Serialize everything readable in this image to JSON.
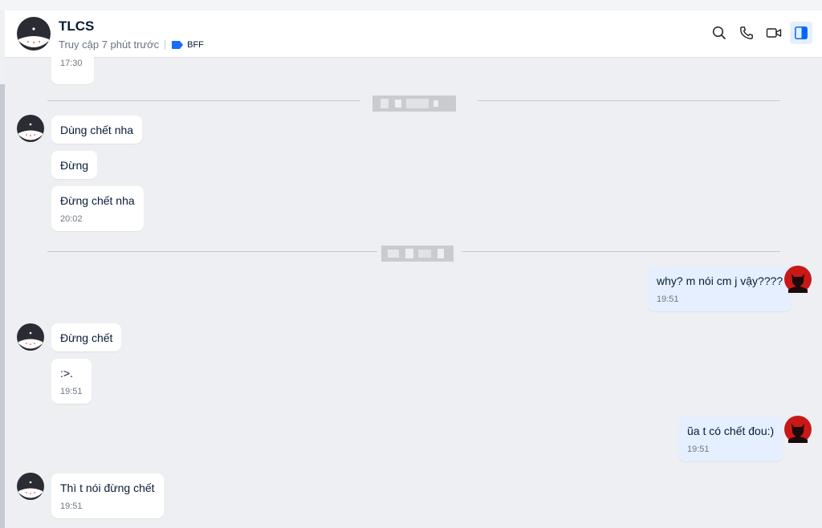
{
  "header": {
    "title": "TLCS",
    "last_seen": "Truy cập 7 phút trước",
    "tag": "BFF",
    "tag_color": "#1a6dfa"
  },
  "icons": [
    "search-icon",
    "phone-icon",
    "video-camera-icon",
    "sidebar-toggle-icon"
  ],
  "colors": {
    "accent": "#0068ff",
    "my_bubble": "#e5efff",
    "their_bubble": "#ffffff",
    "background": "#eeeff2"
  },
  "messages": {
    "m0": {
      "time": "17:30"
    },
    "m1": {
      "text": "Dùng chết nha"
    },
    "m2": {
      "text": "Đừng"
    },
    "m3": {
      "text": "Đừng chết nha",
      "time": "20:02"
    },
    "m4": {
      "text": "why? m nói cm j vậy????",
      "time": "19:51"
    },
    "m5": {
      "text": "Đừng chết"
    },
    "m6": {
      "text": ":>.",
      "time": "19:51"
    },
    "m7": {
      "text": "ũa t có chết đou:)",
      "time": "19:51"
    },
    "m8": {
      "text": "Thì t nói đừng chết",
      "time": "19:51"
    }
  }
}
